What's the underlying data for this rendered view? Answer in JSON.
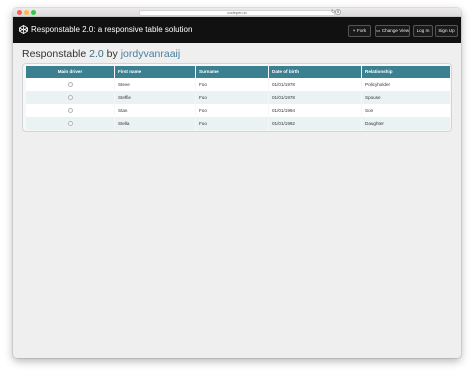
{
  "browser": {
    "url": "codepen.io",
    "reload_glyph": "↻",
    "ext_glyph": "S"
  },
  "header": {
    "title": "Responstable 2.0: a responsive table solution",
    "buttons": {
      "fork": "Fork",
      "fork_icon": "⑂",
      "change_view": "Change View",
      "change_view_icon": "▭",
      "login": "Log In",
      "signup": "Sign Up"
    }
  },
  "page": {
    "heading_prefix": "Responstable",
    "heading_version": "2.0",
    "heading_by": "by",
    "heading_author": "jordyvanraaij"
  },
  "table": {
    "columns": [
      "Main driver",
      "First name",
      "Surname",
      "Date of birth",
      "Relationship"
    ],
    "rows": [
      {
        "first": "Steve",
        "surname": "Foo",
        "dob": "01/01/1978",
        "relationship": "Policyholder"
      },
      {
        "first": "Steffie",
        "surname": "Foo",
        "dob": "01/01/1978",
        "relationship": "Spouse"
      },
      {
        "first": "Stan",
        "surname": "Foo",
        "dob": "01/01/1994",
        "relationship": "Son"
      },
      {
        "first": "Stella",
        "surname": "Foo",
        "dob": "01/01/1992",
        "relationship": "Daughter"
      }
    ]
  },
  "colors": {
    "header_bg": "#111111",
    "table_header_bg": "#3b8091",
    "row_alt_bg": "#eaf2f4",
    "accent_link": "#4a7e9e"
  },
  "icons": [
    "pen-logo-icon",
    "fork-icon",
    "change-view-icon",
    "reload-icon",
    "extension-icon"
  ]
}
